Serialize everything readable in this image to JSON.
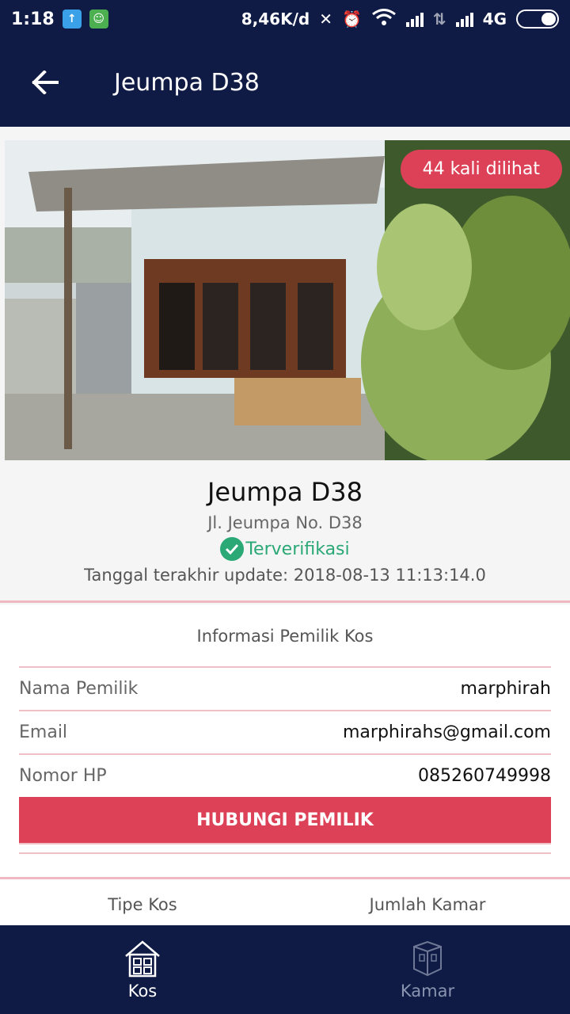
{
  "status_bar": {
    "time": "1:18",
    "network_speed": "8,46K/d",
    "network_type": "4G",
    "icons": [
      "upload-icon",
      "android-icon",
      "vibrate-off-icon",
      "alarm-icon",
      "wifi-icon",
      "signal-icon",
      "data-arrows-icon",
      "signal-icon",
      "battery-icon"
    ]
  },
  "app_bar": {
    "title": "Jeumpa D38",
    "back_icon": "arrow-left-icon"
  },
  "listing": {
    "views_badge": "44 kali dilihat",
    "name": "Jeumpa D38",
    "address": "Jl. Jeumpa No. D38",
    "verified_label": "Terverifikasi",
    "last_update": "Tanggal terakhir update: 2018-08-13 11:13:14.0"
  },
  "owner_info": {
    "section_title": "Informasi Pemilik Kos",
    "rows": [
      {
        "label": "Nama Pemilik",
        "value": "marphirah"
      },
      {
        "label": "Email",
        "value": "marphirahs@gmail.com"
      },
      {
        "label": "Nomor HP",
        "value": "085260749998"
      }
    ],
    "contact_button": "HUBUNGI PEMILIK"
  },
  "kos_info": {
    "type_label": "Tipe Kos",
    "rooms_label": "Jumlah Kamar"
  },
  "bottom_nav": {
    "items": [
      {
        "label": "Kos",
        "icon": "house-icon",
        "active": true
      },
      {
        "label": "Kamar",
        "icon": "room-icon",
        "active": false
      }
    ]
  },
  "colors": {
    "primary_dark": "#0f1b45",
    "accent": "#dc4157",
    "verified": "#2aa876",
    "divider": "#f0b8c2"
  }
}
